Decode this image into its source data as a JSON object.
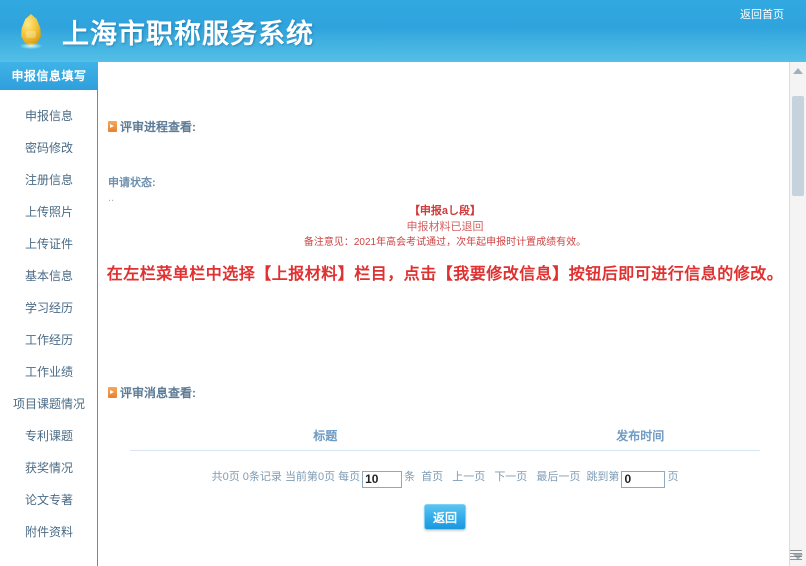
{
  "header": {
    "site_title": "上海市职称服务系统",
    "home_link": "返回首页",
    "logo_icon": "flame-emblem-icon",
    "brand_color": "#2f9fdc"
  },
  "sidebar": {
    "heading": "申报信息填写",
    "items": [
      {
        "label": "申报信息"
      },
      {
        "label": "密码修改"
      },
      {
        "label": "注册信息"
      },
      {
        "label": "上传照片"
      },
      {
        "label": "上传证件"
      },
      {
        "label": "基本信息"
      },
      {
        "label": "学习经历"
      },
      {
        "label": "工作经历"
      },
      {
        "label": "工作业绩"
      },
      {
        "label": "项目课题情况"
      },
      {
        "label": "专利课题"
      },
      {
        "label": "获奖情况"
      },
      {
        "label": "论文专著"
      },
      {
        "label": "附件资料"
      }
    ]
  },
  "main": {
    "progress_section": {
      "title": "评审进程查看:",
      "bullet_icon": "orange-arrow-bullet-icon",
      "apply_status_label": "申请状态:",
      "apply_status_value": "..",
      "status_line1": "【申报аし段】",
      "status_line2": "申报材料已退回",
      "status_line3": "备注意见：2021年高会考试通过，次年起申报时计置成绩有效。",
      "instruction": "在左栏菜单栏中选择【上报材料】栏目，点击【我要修改信息】按钮后即可进行信息的修改。",
      "status_color": "#d03a3a",
      "instruction_color": "#e03030"
    },
    "message_section": {
      "title": "评审消息查看:",
      "bullet_icon": "orange-arrow-bullet-icon",
      "columns": [
        "标题",
        "发布时间"
      ],
      "rows": [],
      "pager": {
        "total_prefix": "共",
        "total_pages": "0",
        "pages_unit": "页",
        "records_count": "0",
        "records_unit": "条记录",
        "current_prefix": "当前第",
        "current_page": "0",
        "current_unit": "页",
        "per_page_label": "每页",
        "per_page_value": "10",
        "per_page_unit": "条",
        "first_page": "首页",
        "prev_page": "上一页",
        "next_page": "下一页",
        "last_page": "最后一页",
        "jump_label": "跳到第",
        "jump_value": "0",
        "jump_unit": "页"
      },
      "back_button": "返回"
    }
  },
  "scrollbar": {
    "vertical_name": "vertical-scrollbar",
    "track_color": "#f4f4f4",
    "thumb_color": "#c6d3dd"
  }
}
